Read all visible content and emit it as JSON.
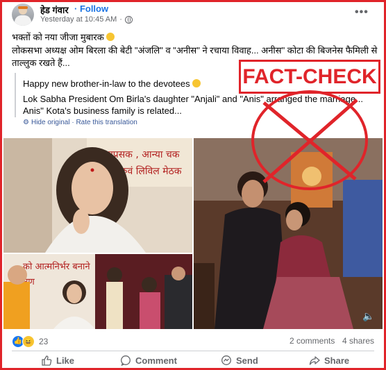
{
  "post": {
    "author": "हेड गंवार",
    "follow": "· Follow",
    "timestamp": "Yesterday at 10:45 AM",
    "privacy_sep": "·",
    "more_icon": "more-options-icon",
    "text_line1": "भक्तों को नया जीजा मुबारक",
    "text_line2": "लोकसभा अध्यक्ष ओम बिरला की बेटी \"अंजलि\" व \"अनीस\" ने रचाया विवाह... अनीस\" कोटा की बिजनेस फैमिली से ताल्लुक रखते हैं...",
    "translation_line1": "Happy new brother-in-law to the devotees",
    "translation_line2": "Lok Sabha President Om Birla's daughter \"Anjali\" and \"Anis\" arranged the marriage... Anis\" Kota's business family is related...",
    "hide_original": "Hide original",
    "rate_translation": "· Rate this translation"
  },
  "overlay": {
    "label": "FACT-CHECK",
    "accent": "#e0242a"
  },
  "media": {
    "banner_left_text": "एप्रसक , आन्या चक",
    "banner_left_text2": "र रुवं लिविल मेठक",
    "banner_bottom_text": "को आत्मनिर्भर बनाने",
    "banner_bottom_text2": "रण"
  },
  "footer": {
    "reaction_count": "23",
    "comments": "2 comments",
    "shares": "4 shares",
    "like": "Like",
    "comment": "Comment",
    "send": "Send",
    "share": "Share"
  },
  "colors": {
    "link_blue": "#1b74e4",
    "secondary_text": "#65676b",
    "frame_red": "#e0242a"
  }
}
